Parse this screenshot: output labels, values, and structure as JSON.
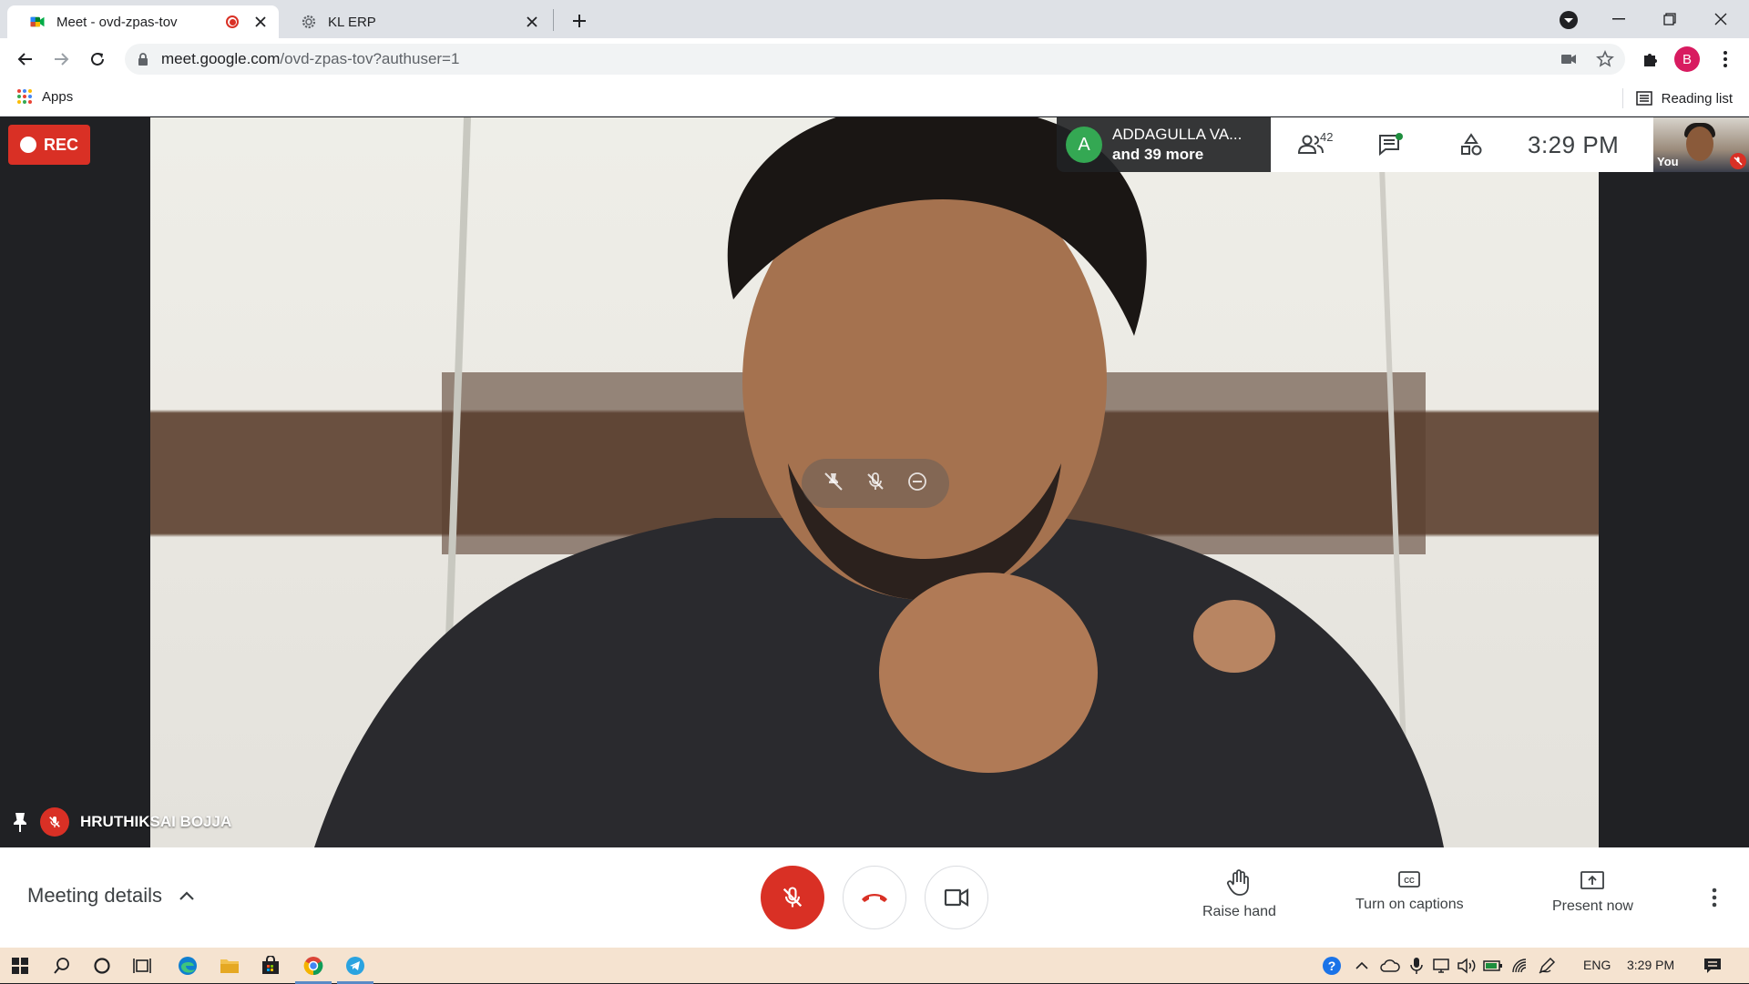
{
  "browser": {
    "tabs": [
      {
        "title": "Meet - ovd-zpas-tov",
        "recording": true,
        "active": true
      },
      {
        "title": "KL ERP",
        "active": false
      }
    ],
    "address": {
      "host": "meet.google.com",
      "path": "/ovd-zpas-tov?authuser=1"
    },
    "profile_initial": "B",
    "bookmarks": {
      "apps_label": "Apps",
      "reading_list_label": "Reading list"
    }
  },
  "meet": {
    "rec_label": "REC",
    "participants_chip": {
      "avatar_initial": "A",
      "line1": "ADDAGULLA VA...",
      "line2": "and 39 more"
    },
    "people_count": "42",
    "clock": "3:29  PM",
    "self_label": "You",
    "speaker_name": "HRUTHIKSAI BOJJA",
    "meeting_details_label": "Meeting details",
    "actions": {
      "raise_hand": "Raise hand",
      "captions": "Turn on captions",
      "present": "Present now"
    },
    "colors": {
      "danger": "#d93025",
      "accent_green": "#34a853",
      "chat_dot": "#1a73e8"
    }
  },
  "taskbar": {
    "lang": "ENG",
    "time": "3:29 PM"
  }
}
